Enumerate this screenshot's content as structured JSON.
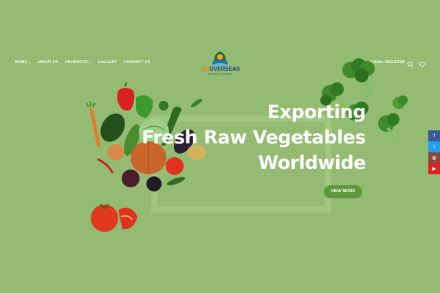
{
  "nav": {
    "items": [
      {
        "label": "HOME",
        "has_caret": true
      },
      {
        "label": "ABOUT US"
      },
      {
        "label": "PRODUCTS",
        "has_caret": true
      },
      {
        "label": "GALLERY"
      },
      {
        "label": "CONTACT US"
      }
    ],
    "caret": "˅"
  },
  "logo": {
    "prefix": "RR",
    "name": "OVERSEAS",
    "tagline": "EXPORT & IMPORT"
  },
  "header": {
    "login_label": "LOGIN / REGISTER",
    "icons": [
      "search-icon",
      "heart-icon"
    ]
  },
  "hero": {
    "line1": "Exporting",
    "line2": "Fresh Raw Vegetables",
    "line3": "Worldwide",
    "cta_label": "VIEW MORE"
  },
  "social": [
    {
      "name": "facebook-icon",
      "glyph": "f",
      "color": "#3b5998"
    },
    {
      "name": "twitter-icon",
      "glyph": "t",
      "color": "#1da1f2"
    },
    {
      "name": "instagram-icon",
      "glyph": "◎",
      "color": "#8a4a3a"
    },
    {
      "name": "youtube-icon",
      "glyph": "▶",
      "color": "#e02020"
    }
  ],
  "colors": {
    "background": "#93bb72",
    "accent": "#5f9a3a",
    "text": "#ffffff"
  }
}
